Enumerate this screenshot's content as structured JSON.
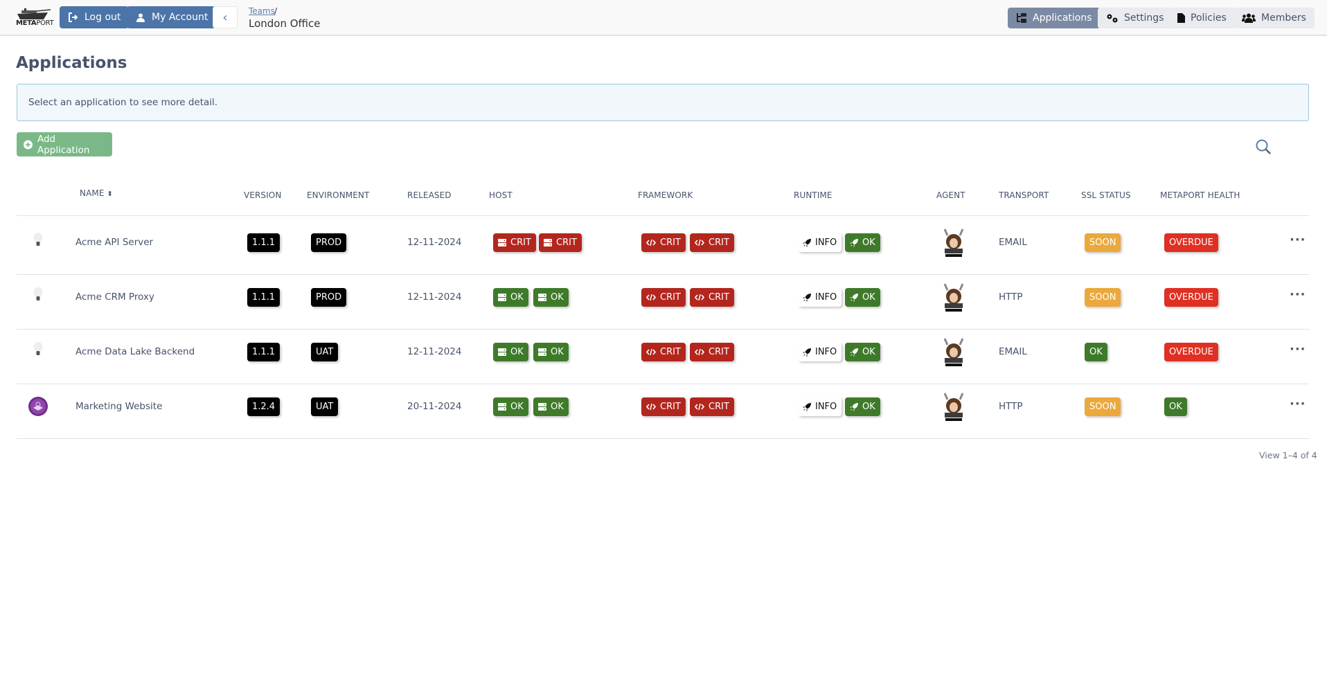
{
  "header": {
    "logo_text_bold": "META",
    "logo_text_light": "PORT",
    "logout_label": "Log out",
    "account_label": "My Account",
    "breadcrumb_link": "Teams",
    "breadcrumb_sep": "/",
    "breadcrumb_current": "London Office",
    "nav": [
      {
        "label": "Applications",
        "icon": "sitemap-icon",
        "active": true
      },
      {
        "label": "Settings",
        "icon": "gears-icon",
        "active": false
      },
      {
        "label": "Policies",
        "icon": "file-icon",
        "active": false
      },
      {
        "label": "Members",
        "icon": "users-icon",
        "active": false
      }
    ]
  },
  "page": {
    "title": "Applications",
    "info": "Select an application to see more detail.",
    "add_label": "Add Application",
    "pager": "View 1–4 of 4"
  },
  "table": {
    "columns": [
      "NAME",
      "VERSION",
      "ENVIRONMENT",
      "RELEASED",
      "HOST",
      "FRAMEWORK",
      "RUNTIME",
      "AGENT",
      "TRANSPORT",
      "SSL STATUS",
      "METAPORT HEALTH"
    ],
    "rows": [
      {
        "icon": "lightbulb",
        "name": "Acme API Server",
        "version": "1.1.1",
        "env": "PROD",
        "released": "12-11-2024",
        "host": [
          "CRIT",
          "CRIT"
        ],
        "framework": [
          "CRIT",
          "CRIT"
        ],
        "runtime": [
          "INFO",
          "OK"
        ],
        "agent": "composer-logo",
        "transport": "EMAIL",
        "ssl": "SOON",
        "health": "OVERDUE"
      },
      {
        "icon": "lightbulb",
        "name": "Acme CRM Proxy",
        "version": "1.1.1",
        "env": "PROD",
        "released": "12-11-2024",
        "host": [
          "OK",
          "OK"
        ],
        "framework": [
          "CRIT",
          "CRIT"
        ],
        "runtime": [
          "INFO",
          "OK"
        ],
        "agent": "composer-logo",
        "transport": "HTTP",
        "ssl": "SOON",
        "health": "OVERDUE"
      },
      {
        "icon": "lightbulb",
        "name": "Acme Data Lake Backend",
        "version": "1.1.1",
        "env": "UAT",
        "released": "12-11-2024",
        "host": [
          "OK",
          "OK"
        ],
        "framework": [
          "CRIT",
          "CRIT"
        ],
        "runtime": [
          "INFO",
          "OK"
        ],
        "agent": "composer-logo",
        "transport": "EMAIL",
        "ssl": "OK",
        "health": "OVERDUE"
      },
      {
        "icon": "purple-app",
        "name": "Marketing Website",
        "version": "1.2.4",
        "env": "UAT",
        "released": "20-11-2024",
        "host": [
          "OK",
          "OK"
        ],
        "framework": [
          "CRIT",
          "CRIT"
        ],
        "runtime": [
          "INFO",
          "OK"
        ],
        "agent": "composer-logo",
        "transport": "HTTP",
        "ssl": "SOON",
        "health": "OK"
      }
    ]
  },
  "colors": {
    "primary": "#4b74a8",
    "crit": "#b3261e",
    "ok": "#3e7a2a",
    "soon": "#eba93c",
    "overdue": "#df3023",
    "add": "#7ab987"
  }
}
